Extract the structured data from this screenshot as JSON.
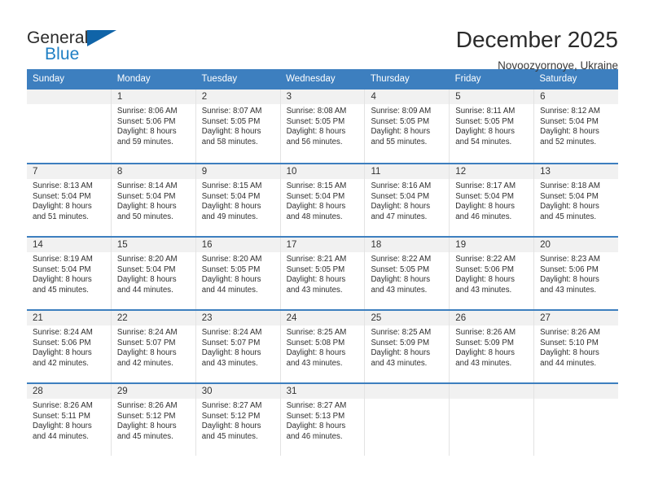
{
  "brand": {
    "name_top": "General",
    "name_bottom": "Blue",
    "triangle_color": "#1064a8",
    "blue_text_color": "#1f7fc4"
  },
  "header": {
    "month_title": "December 2025",
    "location": "Novoozyornoye, Ukraine"
  },
  "colors": {
    "header_bar": "#3d7fbf",
    "daynum_band": "#f1f1f1",
    "cell_border": "#e3e3e3",
    "text": "#2f2f2f"
  },
  "weekdays": [
    "Sunday",
    "Monday",
    "Tuesday",
    "Wednesday",
    "Thursday",
    "Friday",
    "Saturday"
  ],
  "labels": {
    "sunrise_prefix": "Sunrise:",
    "sunset_prefix": "Sunset:",
    "daylight_prefix": "Daylight:"
  },
  "weeks": [
    [
      {
        "day": "",
        "line1": "",
        "line2": "",
        "line3": "",
        "line4": ""
      },
      {
        "day": "1",
        "line1": "Sunrise: 8:06 AM",
        "line2": "Sunset: 5:06 PM",
        "line3": "Daylight: 8 hours",
        "line4": "and 59 minutes."
      },
      {
        "day": "2",
        "line1": "Sunrise: 8:07 AM",
        "line2": "Sunset: 5:05 PM",
        "line3": "Daylight: 8 hours",
        "line4": "and 58 minutes."
      },
      {
        "day": "3",
        "line1": "Sunrise: 8:08 AM",
        "line2": "Sunset: 5:05 PM",
        "line3": "Daylight: 8 hours",
        "line4": "and 56 minutes."
      },
      {
        "day": "4",
        "line1": "Sunrise: 8:09 AM",
        "line2": "Sunset: 5:05 PM",
        "line3": "Daylight: 8 hours",
        "line4": "and 55 minutes."
      },
      {
        "day": "5",
        "line1": "Sunrise: 8:11 AM",
        "line2": "Sunset: 5:05 PM",
        "line3": "Daylight: 8 hours",
        "line4": "and 54 minutes."
      },
      {
        "day": "6",
        "line1": "Sunrise: 8:12 AM",
        "line2": "Sunset: 5:04 PM",
        "line3": "Daylight: 8 hours",
        "line4": "and 52 minutes."
      }
    ],
    [
      {
        "day": "7",
        "line1": "Sunrise: 8:13 AM",
        "line2": "Sunset: 5:04 PM",
        "line3": "Daylight: 8 hours",
        "line4": "and 51 minutes."
      },
      {
        "day": "8",
        "line1": "Sunrise: 8:14 AM",
        "line2": "Sunset: 5:04 PM",
        "line3": "Daylight: 8 hours",
        "line4": "and 50 minutes."
      },
      {
        "day": "9",
        "line1": "Sunrise: 8:15 AM",
        "line2": "Sunset: 5:04 PM",
        "line3": "Daylight: 8 hours",
        "line4": "and 49 minutes."
      },
      {
        "day": "10",
        "line1": "Sunrise: 8:15 AM",
        "line2": "Sunset: 5:04 PM",
        "line3": "Daylight: 8 hours",
        "line4": "and 48 minutes."
      },
      {
        "day": "11",
        "line1": "Sunrise: 8:16 AM",
        "line2": "Sunset: 5:04 PM",
        "line3": "Daylight: 8 hours",
        "line4": "and 47 minutes."
      },
      {
        "day": "12",
        "line1": "Sunrise: 8:17 AM",
        "line2": "Sunset: 5:04 PM",
        "line3": "Daylight: 8 hours",
        "line4": "and 46 minutes."
      },
      {
        "day": "13",
        "line1": "Sunrise: 8:18 AM",
        "line2": "Sunset: 5:04 PM",
        "line3": "Daylight: 8 hours",
        "line4": "and 45 minutes."
      }
    ],
    [
      {
        "day": "14",
        "line1": "Sunrise: 8:19 AM",
        "line2": "Sunset: 5:04 PM",
        "line3": "Daylight: 8 hours",
        "line4": "and 45 minutes."
      },
      {
        "day": "15",
        "line1": "Sunrise: 8:20 AM",
        "line2": "Sunset: 5:04 PM",
        "line3": "Daylight: 8 hours",
        "line4": "and 44 minutes."
      },
      {
        "day": "16",
        "line1": "Sunrise: 8:20 AM",
        "line2": "Sunset: 5:05 PM",
        "line3": "Daylight: 8 hours",
        "line4": "and 44 minutes."
      },
      {
        "day": "17",
        "line1": "Sunrise: 8:21 AM",
        "line2": "Sunset: 5:05 PM",
        "line3": "Daylight: 8 hours",
        "line4": "and 43 minutes."
      },
      {
        "day": "18",
        "line1": "Sunrise: 8:22 AM",
        "line2": "Sunset: 5:05 PM",
        "line3": "Daylight: 8 hours",
        "line4": "and 43 minutes."
      },
      {
        "day": "19",
        "line1": "Sunrise: 8:22 AM",
        "line2": "Sunset: 5:06 PM",
        "line3": "Daylight: 8 hours",
        "line4": "and 43 minutes."
      },
      {
        "day": "20",
        "line1": "Sunrise: 8:23 AM",
        "line2": "Sunset: 5:06 PM",
        "line3": "Daylight: 8 hours",
        "line4": "and 43 minutes."
      }
    ],
    [
      {
        "day": "21",
        "line1": "Sunrise: 8:24 AM",
        "line2": "Sunset: 5:06 PM",
        "line3": "Daylight: 8 hours",
        "line4": "and 42 minutes."
      },
      {
        "day": "22",
        "line1": "Sunrise: 8:24 AM",
        "line2": "Sunset: 5:07 PM",
        "line3": "Daylight: 8 hours",
        "line4": "and 42 minutes."
      },
      {
        "day": "23",
        "line1": "Sunrise: 8:24 AM",
        "line2": "Sunset: 5:07 PM",
        "line3": "Daylight: 8 hours",
        "line4": "and 43 minutes."
      },
      {
        "day": "24",
        "line1": "Sunrise: 8:25 AM",
        "line2": "Sunset: 5:08 PM",
        "line3": "Daylight: 8 hours",
        "line4": "and 43 minutes."
      },
      {
        "day": "25",
        "line1": "Sunrise: 8:25 AM",
        "line2": "Sunset: 5:09 PM",
        "line3": "Daylight: 8 hours",
        "line4": "and 43 minutes."
      },
      {
        "day": "26",
        "line1": "Sunrise: 8:26 AM",
        "line2": "Sunset: 5:09 PM",
        "line3": "Daylight: 8 hours",
        "line4": "and 43 minutes."
      },
      {
        "day": "27",
        "line1": "Sunrise: 8:26 AM",
        "line2": "Sunset: 5:10 PM",
        "line3": "Daylight: 8 hours",
        "line4": "and 44 minutes."
      }
    ],
    [
      {
        "day": "28",
        "line1": "Sunrise: 8:26 AM",
        "line2": "Sunset: 5:11 PM",
        "line3": "Daylight: 8 hours",
        "line4": "and 44 minutes."
      },
      {
        "day": "29",
        "line1": "Sunrise: 8:26 AM",
        "line2": "Sunset: 5:12 PM",
        "line3": "Daylight: 8 hours",
        "line4": "and 45 minutes."
      },
      {
        "day": "30",
        "line1": "Sunrise: 8:27 AM",
        "line2": "Sunset: 5:12 PM",
        "line3": "Daylight: 8 hours",
        "line4": "and 45 minutes."
      },
      {
        "day": "31",
        "line1": "Sunrise: 8:27 AM",
        "line2": "Sunset: 5:13 PM",
        "line3": "Daylight: 8 hours",
        "line4": "and 46 minutes."
      },
      {
        "day": "",
        "line1": "",
        "line2": "",
        "line3": "",
        "line4": ""
      },
      {
        "day": "",
        "line1": "",
        "line2": "",
        "line3": "",
        "line4": ""
      },
      {
        "day": "",
        "line1": "",
        "line2": "",
        "line3": "",
        "line4": ""
      }
    ]
  ]
}
